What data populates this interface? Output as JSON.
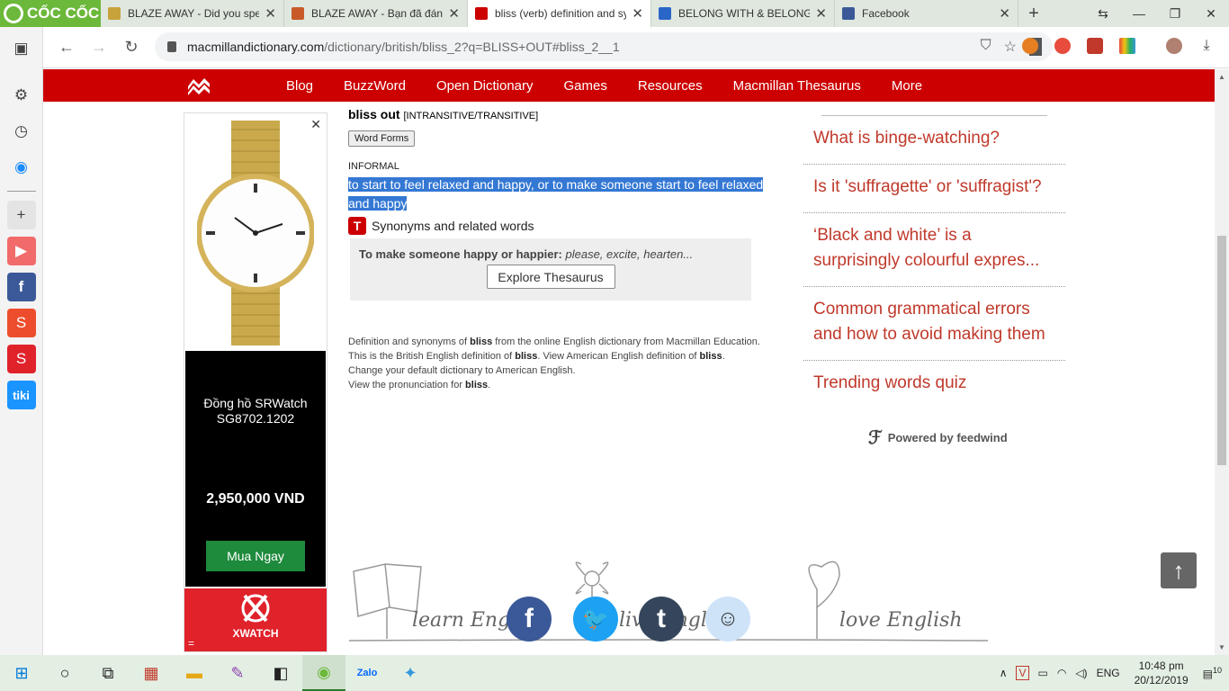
{
  "browser": {
    "brand": "CỐC CỐC",
    "tabs": [
      {
        "title": "BLAZE AWAY - Did you spel",
        "fav_color": "#c7a23a",
        "active": false
      },
      {
        "title": "BLAZE AWAY - Bạn đã đánh",
        "fav_color": "#c85a2a",
        "active": false
      },
      {
        "title": "bliss (verb) definition and sy",
        "fav_color": "#cc0000",
        "active": true
      },
      {
        "title": "BELONG WITH & BELONG T",
        "fav_color": "#2a66c8",
        "active": false
      },
      {
        "title": "Facebook",
        "fav_color": "#3b5998",
        "active": false
      }
    ],
    "url_host": "macmillandictionary.com",
    "url_path": "/dictionary/british/bliss_2?q=BLISS+OUT#bliss_2__1"
  },
  "site_nav": {
    "links": [
      "Blog",
      "BuzzWord",
      "Open Dictionary",
      "Games",
      "Resources",
      "Macmillan Thesaurus",
      "More"
    ]
  },
  "ad": {
    "product_name": "Đồng hồ SRWatch SG8702.1202",
    "price": "2,950,000 VND",
    "buy_label": "Mua Ngay",
    "brand": "XWATCH",
    "eq": "="
  },
  "entry": {
    "phrase": "bliss out",
    "grammar": "[INTRANSITIVE/TRANSITIVE]",
    "word_forms": "Word Forms",
    "register": "INFORMAL",
    "definition": "to start to feel relaxed and happy, or to make someone start to feel relaxed and happy",
    "syn_heading": "Synonyms and related words",
    "thes_label": "To make someone happy or happier:",
    "thes_syns": "please, excite, hearten...",
    "thes_button": "Explore Thesaurus",
    "footnote": {
      "l1a": "Definition and synonyms of ",
      "l1b": " from the online English dictionary from Macmillan Education.",
      "l2a": "This is the British English definition of ",
      "l2b": ". View American English definition of ",
      "l2c": ".",
      "l3": "Change your default dictionary to American English.",
      "l4a": "View the pronunciation for ",
      "l4b": ".",
      "word": "bliss"
    }
  },
  "feed": {
    "items": [
      "What is binge-watching?",
      "Is it 'suffragette' or 'suffragist'?",
      "‘Black and white’ is a surprisingly colourful expres...",
      "Common grammatical errors and how to avoid making them",
      "Trending words quiz"
    ],
    "powered_by": "Powered by feedwind"
  },
  "doodle": {
    "text1": "learn Englis",
    "text2": "live English",
    "text3": "love English"
  },
  "taskbar": {
    "language": "ENG",
    "time": "10:48 pm",
    "date": "20/12/2019",
    "notifications": "10"
  },
  "colors": {
    "brand_red": "#cc0000",
    "link_red": "#c0392b",
    "highlight": "#3478d4",
    "coccoc_green": "#6cb83a"
  }
}
